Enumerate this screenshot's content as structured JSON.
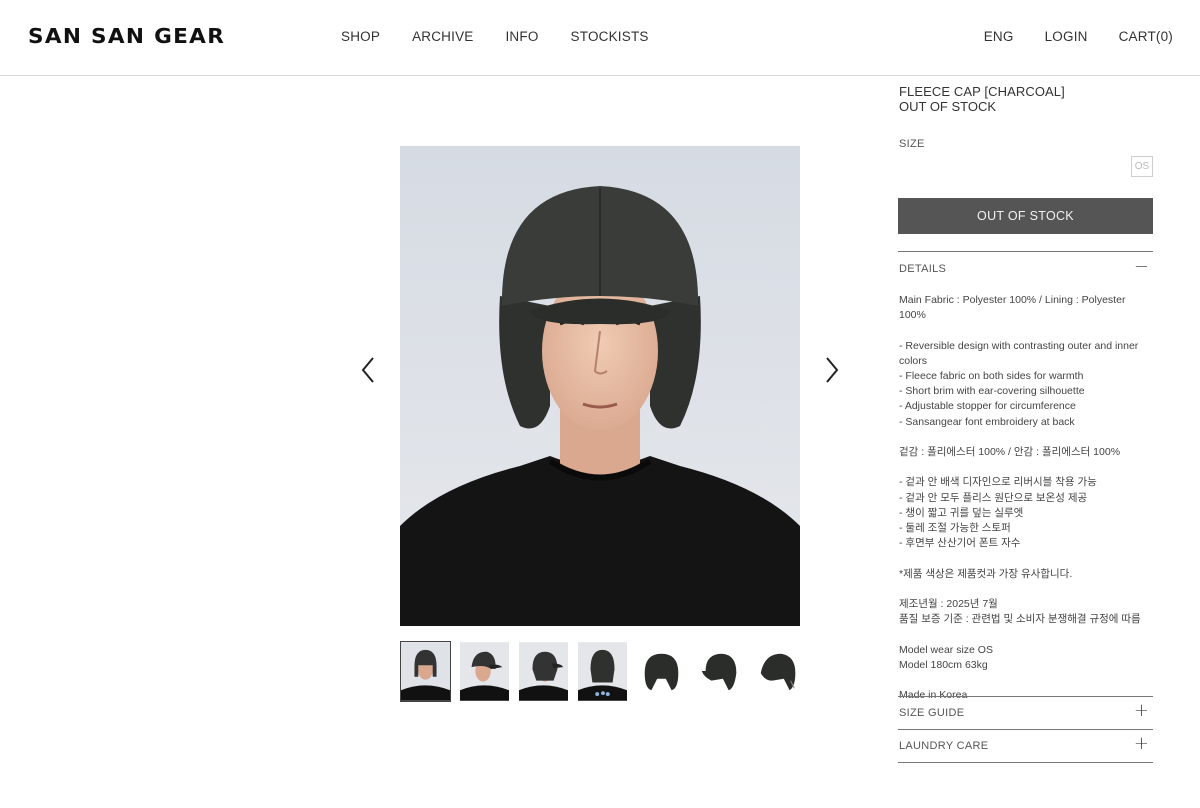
{
  "brand": {
    "logo": "SAN SAN GEAR"
  },
  "nav": {
    "items": [
      "SHOP",
      "ARCHIVE",
      "INFO",
      "STOCKISTS"
    ]
  },
  "utility": {
    "lang": "ENG",
    "login": "LOGIN",
    "cart": "CART(0)"
  },
  "product": {
    "name": "FLEECE CAP [CHARCOAL]",
    "status": "OUT OF STOCK",
    "size_label": "SIZE",
    "size_option": "OS",
    "button_label": "OUT OF STOCK"
  },
  "gallery": {
    "thumbnails": 7,
    "active_index": 0
  },
  "accordion": {
    "details_title": "DETAILS",
    "details_icon": "minus-icon",
    "size_guide_title": "SIZE GUIDE",
    "laundry_title": "LAUNDRY CARE",
    "expand_icon": "plus-icon"
  },
  "details": {
    "fabric": "Main Fabric : Polyester 100% / Lining : Polyester 100%",
    "features_en": "- Reversible design with contrasting outer and inner colors\n- Fleece fabric on both sides for warmth\n- Short brim with ear-covering silhouette\n- Adjustable stopper for circumference\n- Sansangear font embroidery at back",
    "fabric_ko": "겉감 : 폴리에스터 100% / 안감 : 폴리에스터 100%",
    "features_ko": "- 겉과 안 배색 디자인으로 리버시블 착용 가능\n- 겉과 안 모두 플리스 원단으로 보온성 제공\n- 챙이 짧고 귀를 덮는 실루엣\n- 둘레 조절 가능한 스토퍼\n- 후면부 산산기어 폰트 자수",
    "color_note": "*제품 색상은 제품컷과 가장 유사합니다.",
    "manufacture": "제조년월 : 2025년 7월\n품질 보증 기준 : 관련법 및 소비자 분쟁해결 규정에 따름",
    "model": "Model wear size OS\nModel 180cm 63kg",
    "origin": "Made in Korea"
  },
  "colors": {
    "button_bg": "#555555",
    "text": "#333333",
    "divider": "#777777"
  }
}
